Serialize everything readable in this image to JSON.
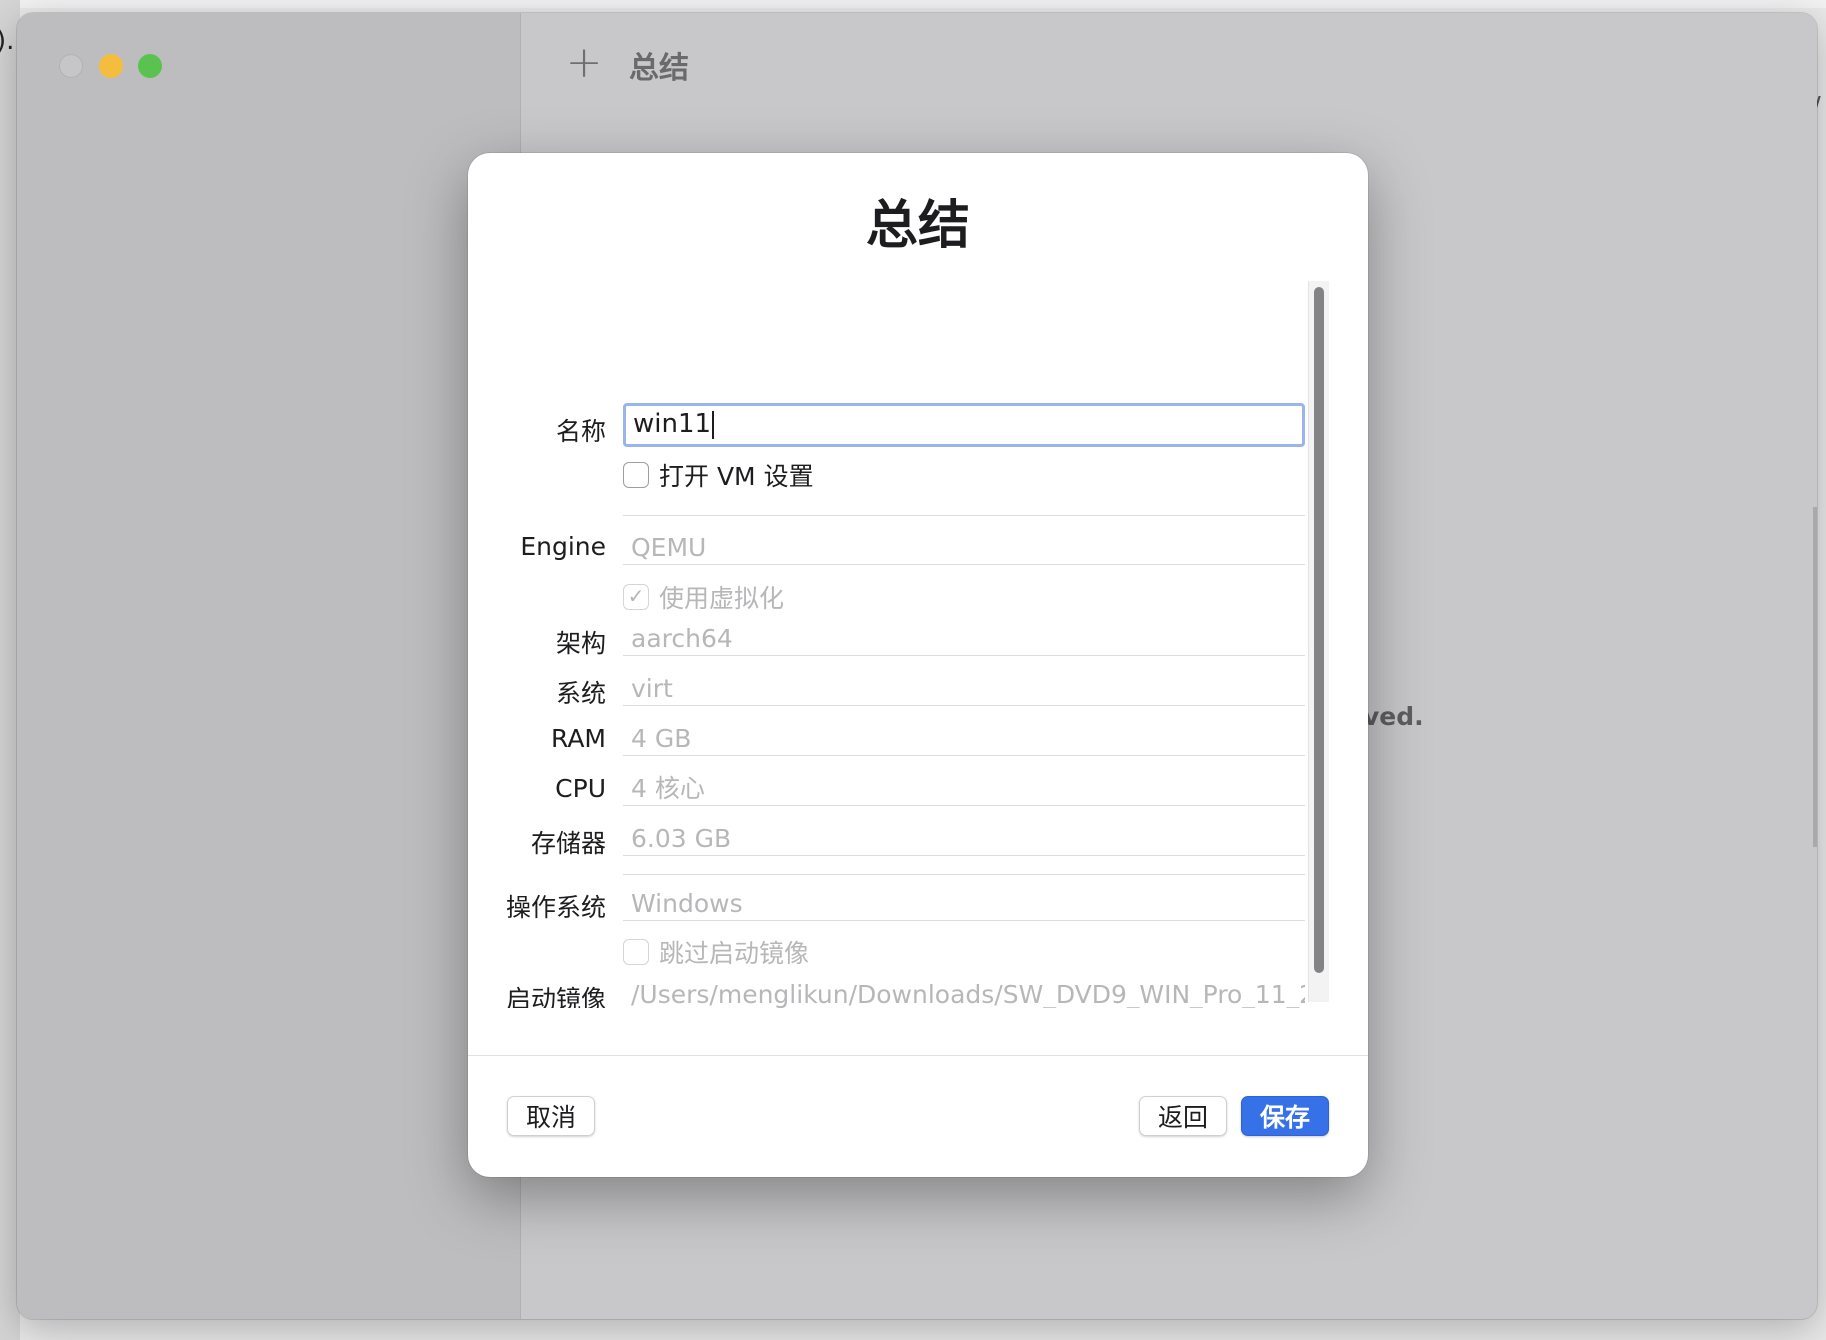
{
  "toolbar": {
    "plus_icon": "plus-icon",
    "title": "总结"
  },
  "background": {
    "behind_text": "ved.",
    "frag_top_left": ").",
    "frag_top_right": "/"
  },
  "sheet": {
    "title": "总结",
    "name": {
      "label": "名称",
      "value": "win11"
    },
    "open_vm_settings": {
      "label": "打开 VM 设置",
      "checked": false
    },
    "engine": {
      "label": "Engine",
      "value": "QEMU"
    },
    "use_virtualization": {
      "label": "使用虚拟化",
      "checked": true
    },
    "architecture": {
      "label": "架构",
      "value": "aarch64"
    },
    "system": {
      "label": "系统",
      "value": "virt"
    },
    "ram": {
      "label": "RAM",
      "value": "4 GB"
    },
    "cpu": {
      "label": "CPU",
      "value": "4 核心"
    },
    "storage": {
      "label": "存储器",
      "value": "6.03 GB"
    },
    "os": {
      "label": "操作系统",
      "value": "Windows"
    },
    "skip_boot_image": {
      "label": "跳过启动镜像",
      "checked": false
    },
    "boot_image": {
      "label": "启动镜像",
      "value": "/Users/menglikun/Downloads/SW_DVD9_WIN_Pro_11_2"
    },
    "buttons": {
      "cancel": "取消",
      "back": "返回",
      "save": "保存"
    }
  },
  "colors": {
    "accent": "#3671e8",
    "focus_ring": "#9cb4ec"
  }
}
